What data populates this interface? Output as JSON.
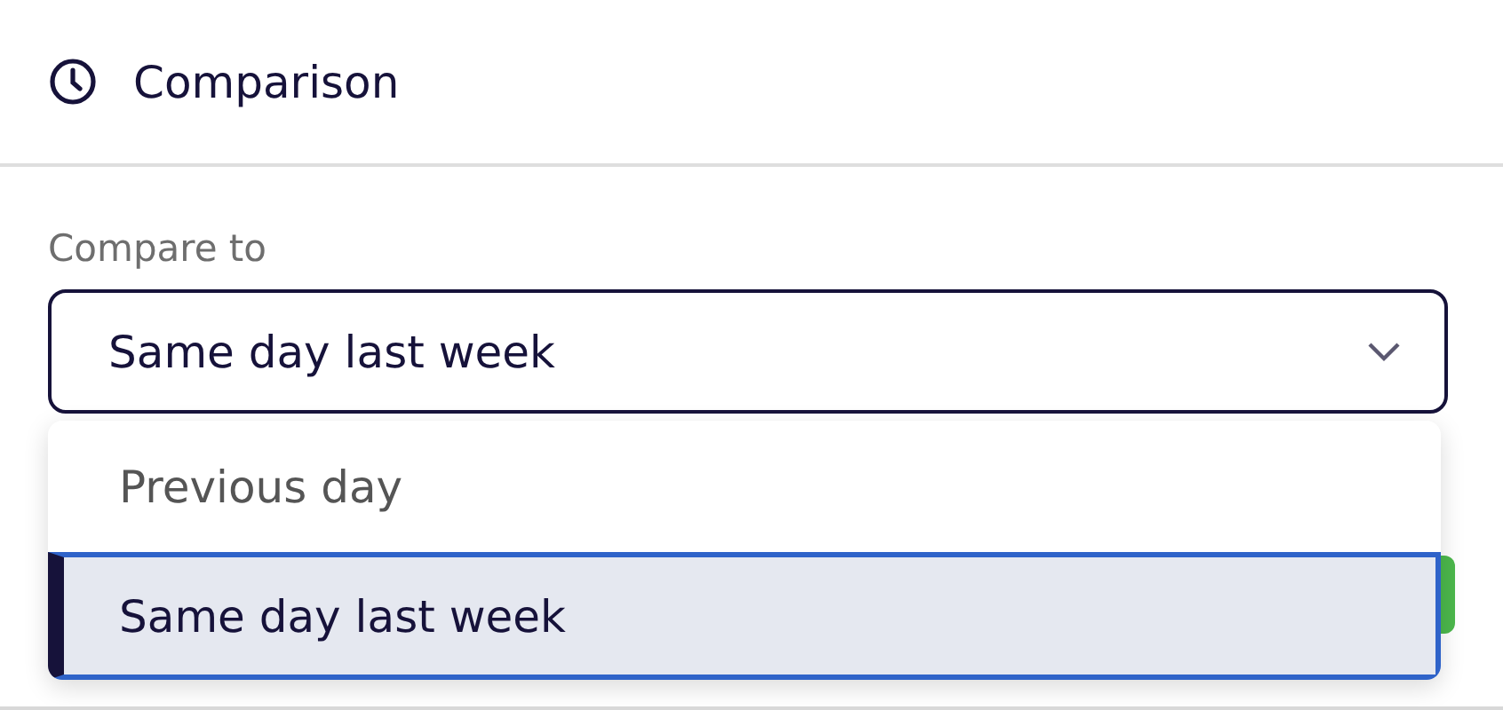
{
  "header": {
    "title": "Comparison"
  },
  "compare": {
    "label": "Compare to",
    "value": "Same day last week",
    "expanded": true
  },
  "options": [
    {
      "label": "Previous day",
      "selected": false
    },
    {
      "label": "Same day last week",
      "selected": true
    }
  ]
}
